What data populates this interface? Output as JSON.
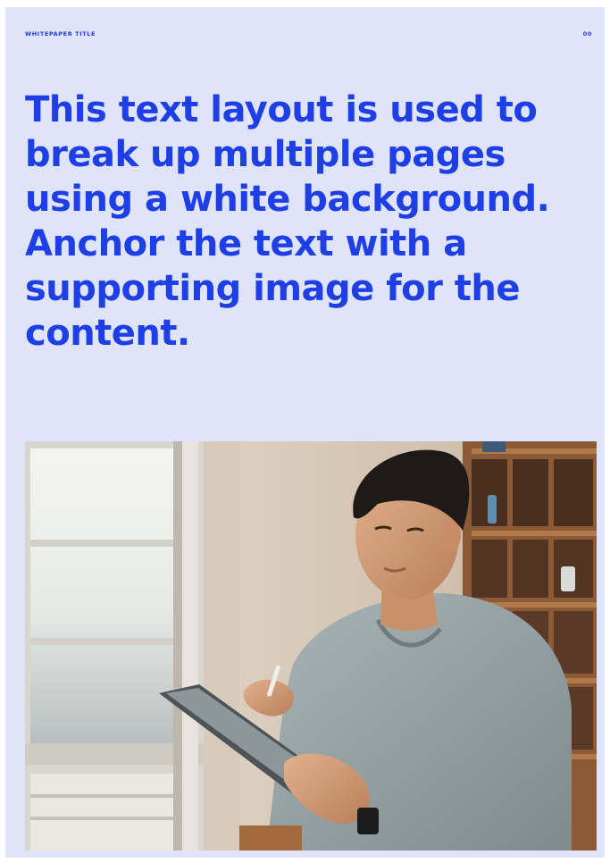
{
  "header": {
    "title": "WHITEPAPER TITLE",
    "page_number": "00"
  },
  "headline": {
    "lines": [
      "This text layout is used to",
      "break up multiple pages",
      "using a white background.",
      "Anchor the text with a",
      "supporting image for the",
      "content."
    ]
  },
  "image": {
    "description_icon": "photo-man-with-tablet"
  },
  "colors": {
    "accent": "#1e3ee6",
    "page_background": "#dfe4fb"
  }
}
